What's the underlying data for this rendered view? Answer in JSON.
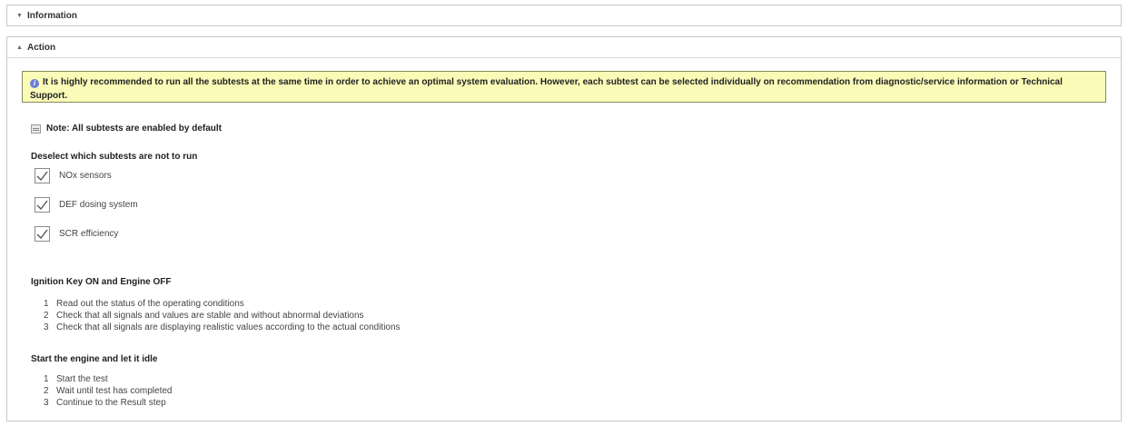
{
  "information_panel": {
    "title": "Information",
    "chevron": "chevron-down-icon"
  },
  "action_panel": {
    "title": "Action",
    "chevron": "chevron-up-icon",
    "notice": {
      "icon": "info-icon",
      "text": "It is highly recommended to run all the subtests at the same time in order to achieve an optimal system evaluation. However, each subtest can be selected individually on recommendation from diagnostic/service information or Technical Support.",
      "background": "#fbfbb8"
    },
    "note": "Note: All subtests are enabled by default",
    "deselect_heading": "Deselect which subtests are not to run",
    "subtests": [
      {
        "label": "NOx sensors",
        "checked": true
      },
      {
        "label": "DEF dosing system",
        "checked": true
      },
      {
        "label": "SCR efficiency",
        "checked": true
      }
    ],
    "section1": {
      "heading": "Ignition Key ON and Engine OFF",
      "steps": [
        {
          "num": "1",
          "text": "Read out the status of the operating conditions"
        },
        {
          "num": "2",
          "text": "Check that all signals and values are stable and without abnormal deviations"
        },
        {
          "num": "3",
          "text": "Check that all signals are displaying realistic values according to the actual conditions"
        }
      ]
    },
    "section2": {
      "heading": "Start the engine and let it idle",
      "steps": [
        {
          "num": "1",
          "text": "Start the test"
        },
        {
          "num": "2",
          "text": "Wait until test has completed"
        },
        {
          "num": "3",
          "text": "Continue to the Result step"
        }
      ]
    }
  }
}
